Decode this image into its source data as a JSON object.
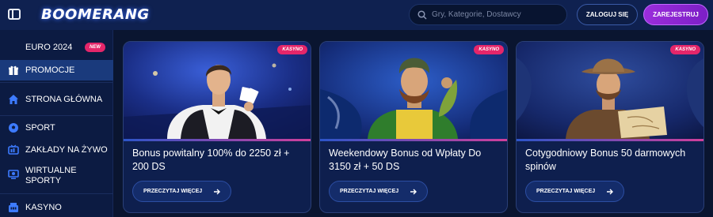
{
  "header": {
    "logo_text": "BOOMERANG",
    "search": {
      "placeholder": "Gry, Kategorie, Dostawcy"
    },
    "login_label": "ZALOGUJ SIĘ",
    "register_label": "ZAREJESTRUJ"
  },
  "sidebar": {
    "items": [
      {
        "label": "EURO 2024",
        "badge": "NEW"
      },
      {
        "label": "PROMOCJE",
        "icon": "gift-icon",
        "active": true
      },
      {
        "label": "STRONA GŁÓWNA",
        "icon": "home-icon"
      },
      {
        "label": "SPORT",
        "icon": "soccer-ball-icon"
      },
      {
        "label": "ZAKŁADY NA ŻYWO",
        "icon": "live-betting-icon"
      },
      {
        "label": "WIRTUALNE",
        "label2": "SPORTY",
        "icon": "virtual-sports-icon"
      },
      {
        "label": "KASYNO",
        "icon": "casino-icon"
      }
    ]
  },
  "cards": [
    {
      "badge": "KASYNO",
      "title": "Bonus powitalny 100% do 2250 zł + 200 DS",
      "button": "PRZECZYTAJ WIĘCEJ",
      "image": "croupier-image"
    },
    {
      "badge": "KASYNO",
      "title": "Weekendowy Bonus od Wpłaty Do 3150 zł + 50 DS",
      "button": "PRZECZYTAJ WIĘCEJ",
      "image": "fisherman-image"
    },
    {
      "badge": "KASYNO",
      "title": "Cotygodniowy Bonus 50 darmowych spinów",
      "button": "PRZECZYTAJ WIĘCEJ",
      "image": "explorer-image"
    }
  ],
  "colors": {
    "background": "#0a1530",
    "header": "#0f2150",
    "sidebar": "#0c1b42",
    "active_item": "#1a3a7c",
    "badge": "#e5266a",
    "register": "#9b2ddb"
  }
}
